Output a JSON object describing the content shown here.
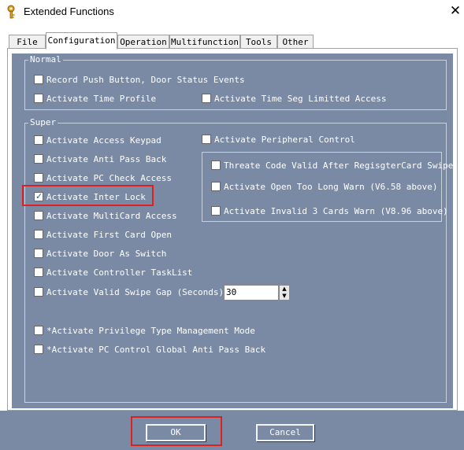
{
  "window": {
    "title": "Extended Functions",
    "icon": "key-icon",
    "close_glyph": "✕"
  },
  "tabs": [
    {
      "label": "File",
      "active": false
    },
    {
      "label": "Configuration",
      "active": true
    },
    {
      "label": "Operation",
      "active": false
    },
    {
      "label": "Multifunction",
      "active": false
    },
    {
      "label": "Tools",
      "active": false
    },
    {
      "label": "Other",
      "active": false
    }
  ],
  "normal": {
    "legend": "Normal",
    "items": [
      {
        "label": "Record Push Button, Door Status Events",
        "checked": false
      },
      {
        "label": "Activate Time Profile",
        "checked": false
      },
      {
        "label": "Activate Time Seg Limitted Access",
        "checked": false
      }
    ]
  },
  "super": {
    "legend": "Super",
    "left_items": [
      {
        "label": "Activate Access Keypad",
        "checked": false
      },
      {
        "label": "Activate Anti Pass Back",
        "checked": false
      },
      {
        "label": "Activate PC Check Access",
        "checked": false
      },
      {
        "label": "Activate Inter Lock",
        "checked": true
      },
      {
        "label": "Activate MultiCard Access",
        "checked": false
      },
      {
        "label": "Activate First Card Open",
        "checked": false
      },
      {
        "label": "Activate Door As Switch",
        "checked": false
      },
      {
        "label": "Activate Controller TaskList",
        "checked": false
      },
      {
        "label": "Activate Valid Swipe Gap (Seconds)",
        "checked": false
      },
      {
        "label": "*Activate Privilege Type Management Mode",
        "checked": false
      },
      {
        "label": "*Activate PC Control Global Anti Pass Back",
        "checked": false
      }
    ],
    "peripheral": {
      "label": "Activate Peripheral Control",
      "checked": false
    },
    "peripheral_items": [
      {
        "label": "Threate Code Valid After RegisgterCard Swipe",
        "checked": false
      },
      {
        "label": "Activate Open Too Long Warn (V6.58 above)",
        "checked": false
      },
      {
        "label": "Activate Invalid 3 Cards  Warn (V8.96 above)",
        "checked": false
      }
    ],
    "swipe_gap_value": "30"
  },
  "buttons": {
    "ok": "OK",
    "cancel": "Cancel"
  },
  "colors": {
    "panel": "#7a8aa4",
    "highlight": "#e02020",
    "check": "#1a5fb4"
  }
}
